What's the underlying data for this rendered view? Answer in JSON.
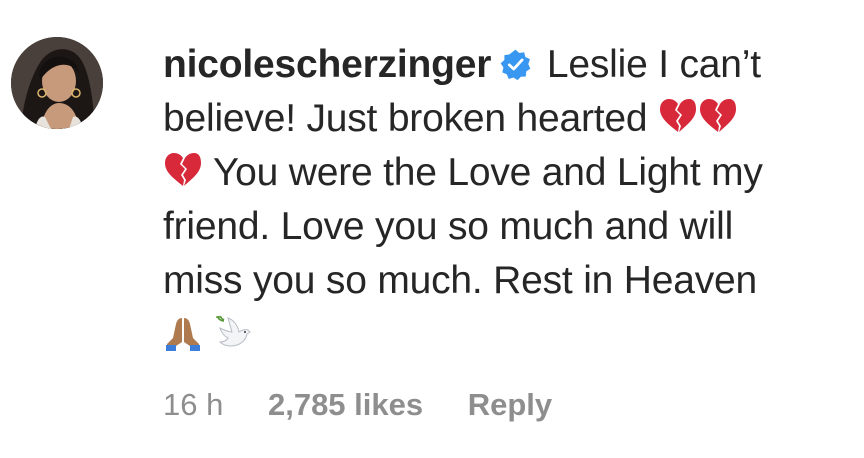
{
  "comment": {
    "username": "nicolescherzinger",
    "verified": true,
    "text_line1": "Leslie I can’t",
    "text_line2": "believe! Just broken hearted",
    "text_line3": "You were the Love and Light my",
    "text_line4": "friend. Love you so much and will",
    "text_line5": "miss you so much. Rest in Heaven",
    "emoji_after_line2": [
      "broken-heart-icon",
      "broken-heart-icon"
    ],
    "emoji_before_line3": [
      "broken-heart-icon"
    ],
    "emoji_line6": [
      "folded-hands-icon",
      "dove-icon"
    ]
  },
  "meta": {
    "time": "16 h",
    "likes": "2,785 likes",
    "reply": "Reply"
  },
  "colors": {
    "text": "#262626",
    "meta": "#8e8e8e",
    "verified": "#3897f0",
    "broken_heart": "#d8293a"
  }
}
